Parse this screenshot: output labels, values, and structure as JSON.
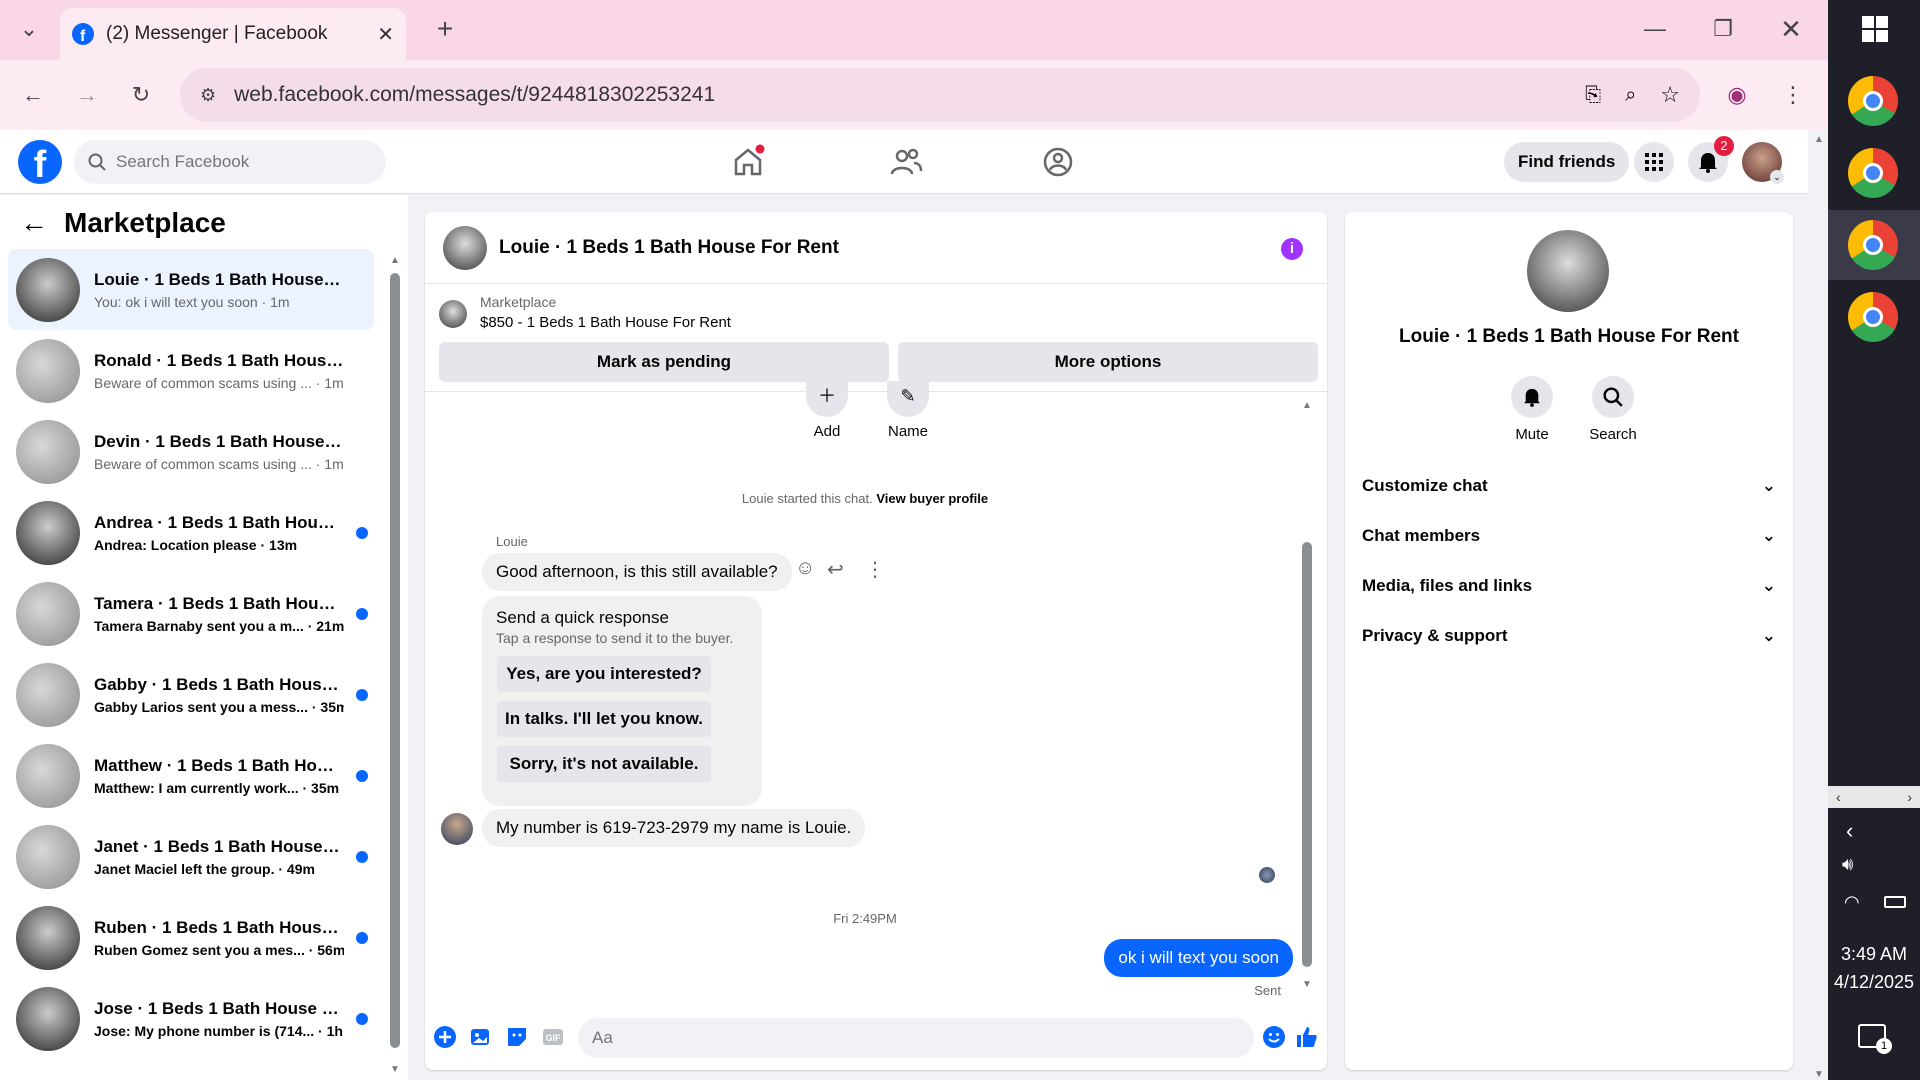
{
  "browser": {
    "tab_title": "(2) Messenger | Facebook",
    "url": "web.facebook.com/messages/t/9244818302253241"
  },
  "facebook": {
    "search_placeholder": "Search Facebook",
    "find_friends": "Find friends",
    "notification_count": "2"
  },
  "left": {
    "title": "Marketplace",
    "conversations": [
      {
        "name": "Louie · 1 Beds 1 Bath House For ...",
        "snippet": "You: ok i will text you soon · 1m",
        "active": true,
        "unread": false
      },
      {
        "name": "Ronald · 1 Beds 1 Bath House Fo...",
        "snippet": "Beware of common scams using ... · 1m",
        "active": false,
        "unread": false
      },
      {
        "name": "Devin · 1 Beds 1 Bath House For...",
        "snippet": "Beware of common scams using ... · 1m",
        "active": false,
        "unread": false
      },
      {
        "name": "Andrea · 1 Beds 1 Bath House ...",
        "snippet": "Andrea: Location please · 13m",
        "active": false,
        "unread": true
      },
      {
        "name": "Tamera · 1 Beds 1 Bath House ...",
        "snippet": "Tamera Barnaby sent you a m... · 21m",
        "active": false,
        "unread": true
      },
      {
        "name": "Gabby · 1 Beds 1 Bath House F...",
        "snippet": "Gabby Larios sent you a mess... · 35m",
        "active": false,
        "unread": true
      },
      {
        "name": "Matthew · 1 Beds 1 Bath Hous...",
        "snippet": "Matthew: I am currently work... · 35m",
        "active": false,
        "unread": true
      },
      {
        "name": "Janet · 1 Beds 1 Bath House F...",
        "snippet": "Janet Maciel left the group. · 49m",
        "active": false,
        "unread": true
      },
      {
        "name": "Ruben · 1 Beds 1 Bath House F...",
        "snippet": "Ruben Gomez sent you a mes... · 56m",
        "active": false,
        "unread": true
      },
      {
        "name": "Jose · 1 Beds 1 Bath House For...",
        "snippet": "Jose: My phone number is (714... · 1h",
        "active": false,
        "unread": true
      }
    ]
  },
  "chat": {
    "title": "Louie · 1 Beds 1 Bath House For Rent",
    "marketplace_label": "Marketplace",
    "listing": "$850 - 1 Beds 1 Bath House For Rent",
    "mark_pending": "Mark as pending",
    "more_options": "More options",
    "add_label": "Add",
    "name_label": "Name",
    "started_text": "Louie started this chat.",
    "view_profile": "View buyer profile",
    "sender": "Louie",
    "msg1": "Good afternoon, is this still available?",
    "quick_title": "Send a quick response",
    "quick_sub": "Tap a response to send it to the buyer.",
    "quick_responses": [
      "Yes, are you interested?",
      "In talks. I'll let you know.",
      "Sorry, it's not available."
    ],
    "msg2": "My number is 619-723-2979 my name is Louie.",
    "timestamp": "Fri 2:49PM",
    "my_msg": "ok i will text you soon",
    "sent_label": "Sent",
    "composer_placeholder": "Aa"
  },
  "right": {
    "title": "Louie · 1 Beds 1 Bath House For Rent",
    "mute": "Mute",
    "search": "Search",
    "sections": [
      "Customize chat",
      "Chat members",
      "Media, files and links",
      "Privacy & support"
    ]
  },
  "taskbar": {
    "time": "3:49 AM",
    "date": "4/12/2025",
    "notif_count": "1"
  },
  "colors": {
    "fb_blue": "#0866ff",
    "tab_bar": "#f9d7e8",
    "info_purple": "#a033ff"
  }
}
